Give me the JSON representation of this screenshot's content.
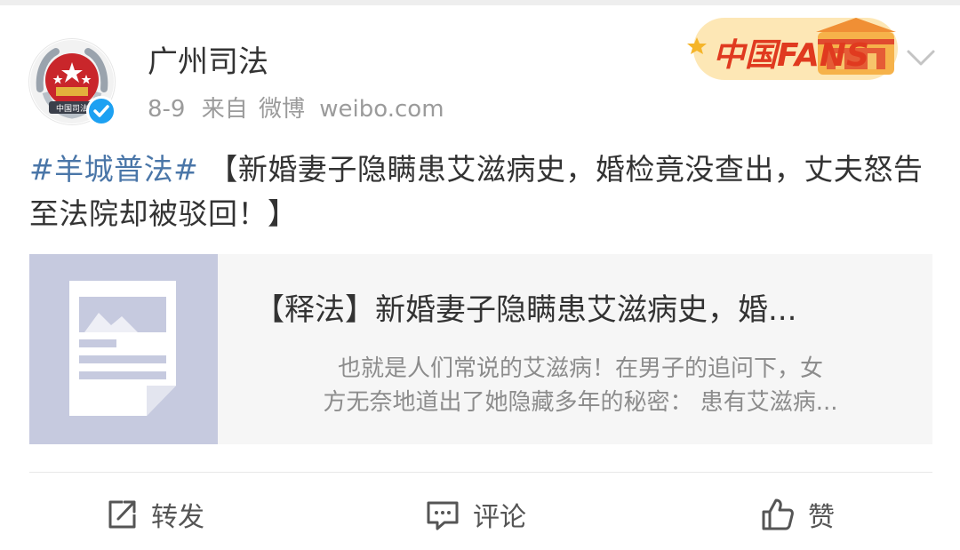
{
  "post": {
    "username": "广州司法",
    "date": "8-9",
    "source_prefix": "来自",
    "source_app": "微博",
    "source_domain": "weibo.com",
    "badge_text": "中国FANS",
    "hashtag": "#羊城普法#",
    "text": "【新婚妻子隐瞒患艾滋病史，婚检竟没查出，丈夫怒告至法院却被驳回！】"
  },
  "card": {
    "title": "【释法】新婚妻子隐瞒患艾滋病史，婚...",
    "desc_line1": "也就是人们常说的艾滋病！在男子的追问下，女",
    "desc_line2": "方无奈地道出了她隐藏多年的秘密： 患有艾滋病..."
  },
  "actions": {
    "forward": "转发",
    "comment": "评论",
    "like": "赞"
  },
  "colors": {
    "hashtag": "#4a76a8",
    "verified": "#1da1f2",
    "text": "#333333",
    "meta": "#9b9b9b",
    "card_bg": "#f6f6f6",
    "thumb_bg": "#c6cadf"
  },
  "icons": [
    "forward-icon",
    "comment-icon",
    "like-icon",
    "verified-icon",
    "chevron-down-icon",
    "article-placeholder-icon"
  ]
}
